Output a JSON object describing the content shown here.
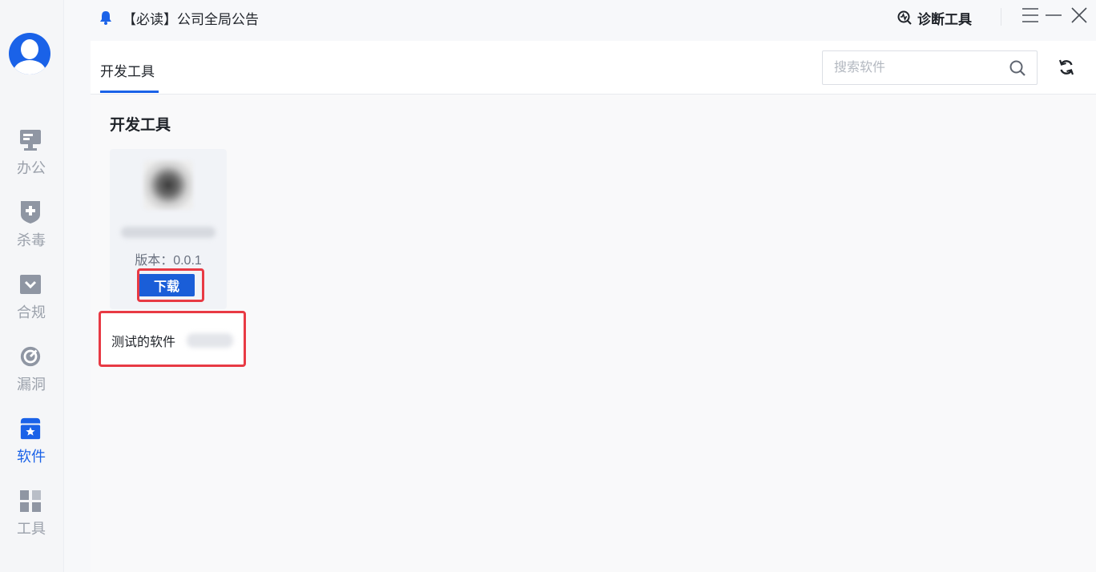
{
  "notice": {
    "text": "【必读】公司全局公告"
  },
  "header": {
    "diagnose_label": "诊断工具"
  },
  "sidebar": {
    "items": [
      {
        "label": "办公",
        "icon": "monitor-icon",
        "active": false
      },
      {
        "label": "杀毒",
        "icon": "shield-plus-icon",
        "active": false
      },
      {
        "label": "合规",
        "icon": "compliance-icon",
        "active": false
      },
      {
        "label": "漏洞",
        "icon": "radar-icon",
        "active": false
      },
      {
        "label": "软件",
        "icon": "software-store-icon",
        "active": true
      },
      {
        "label": "工具",
        "icon": "grid-tools-icon",
        "active": false
      }
    ]
  },
  "tabs": [
    {
      "label": "开发工具",
      "active": true
    }
  ],
  "search": {
    "placeholder": "搜索软件",
    "value": ""
  },
  "main": {
    "section_title": "开发工具",
    "card": {
      "version": "版本：0.0.1",
      "download_label": "下载"
    },
    "tooltip": {
      "text": "测试的软件"
    }
  },
  "colors": {
    "accent": "#1a62e8",
    "highlight": "#e83a44"
  }
}
